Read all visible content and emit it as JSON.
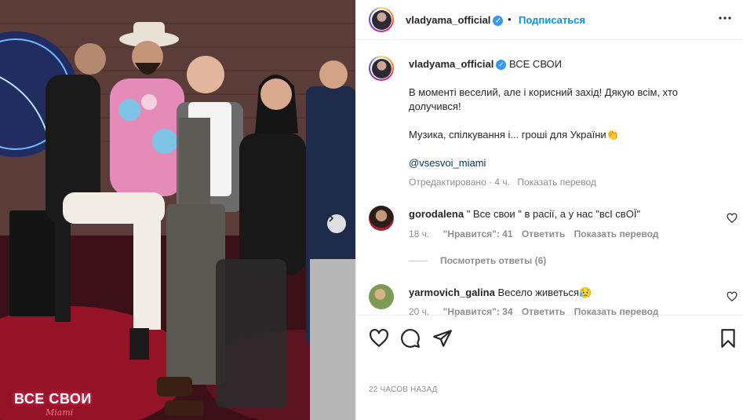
{
  "post": {
    "author": "vladyama_official",
    "separator": "•",
    "follow_label": "Подписаться",
    "more_icon": "more-horizontal-icon"
  },
  "caption": {
    "author": "vladyama_official",
    "title": "ВСЕ СВОИ",
    "line1": "В моменті веселий, але і корисний захід! Дякую всім, хто долучився!",
    "line2": "Музика, спілкування і... гроші для України👏",
    "mention": "@vsesvoi_miami",
    "edited": "Отредактировано · 4 ч.",
    "translate": "Показать перевод"
  },
  "comments": [
    {
      "user": "gorodalena",
      "text": "\" Все свои \" в расії, а у нас \"всІ свОЇ\"",
      "time": "18 ч.",
      "likes": "\"Нравится\": 41",
      "reply": "Ответить",
      "translate": "Показать перевод",
      "view_replies": "Посмотреть ответы (6)"
    },
    {
      "user": "yarmovich_galina",
      "text": "Весело живеться😥",
      "time": "20 ч.",
      "likes": "\"Нравится\": 34",
      "reply": "Ответить",
      "translate": "Показать перевод"
    }
  ],
  "footer": {
    "timestamp": "22 ЧАСОВ НАЗАД"
  },
  "photo": {
    "watermark": "ВСЕ СВОИ",
    "watermark_sub": "Miami"
  },
  "colors": {
    "accent": "#0095f6",
    "verified": "#3897f0",
    "muted": "#8e8e8e",
    "text": "#262626"
  }
}
